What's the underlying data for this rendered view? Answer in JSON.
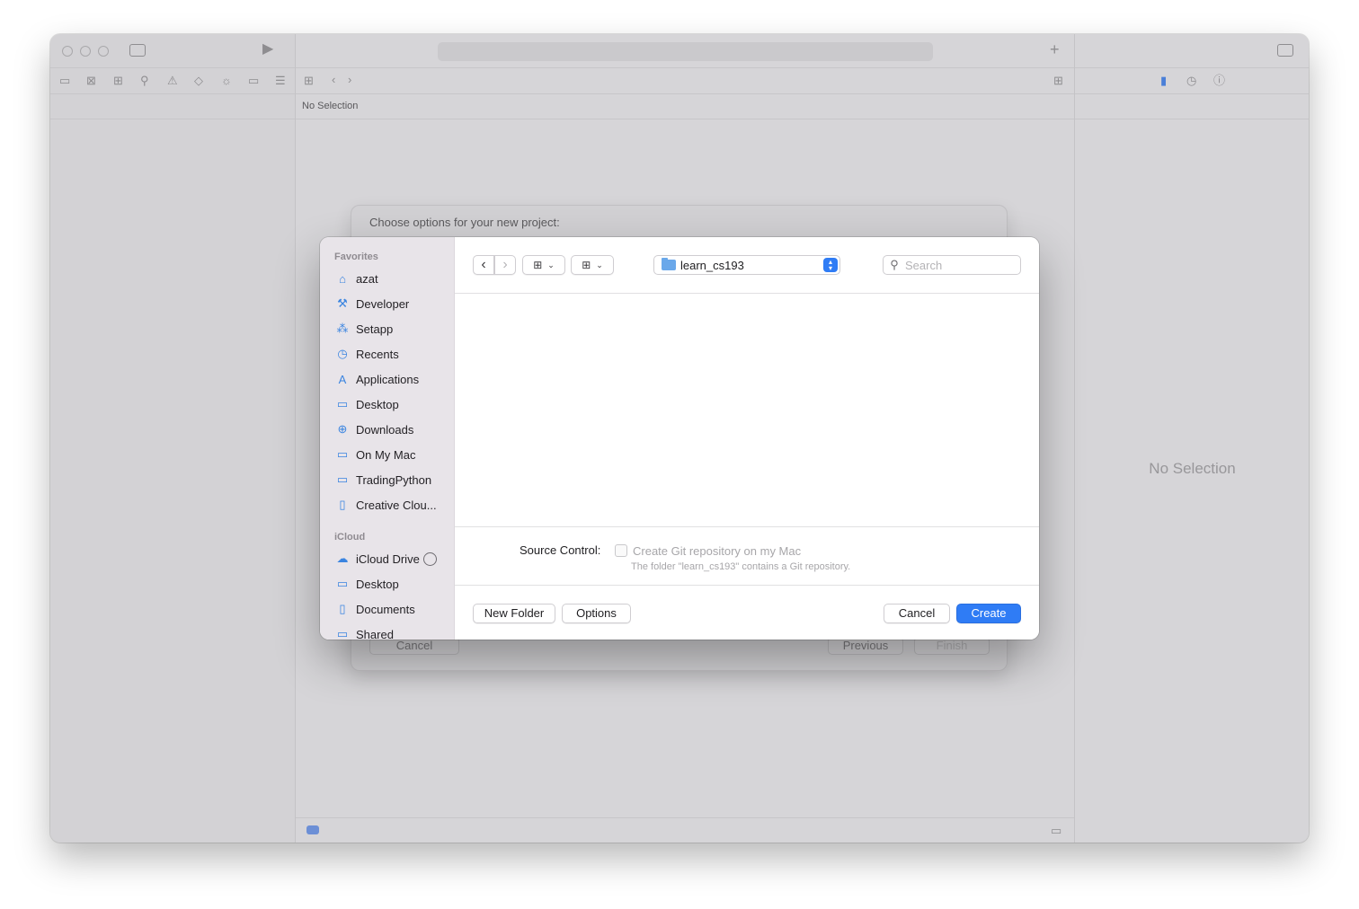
{
  "xcode": {
    "editor_jumpbar_text": "No Selection",
    "inspector_empty_text": "No Selection"
  },
  "background_sheet": {
    "title": "Choose options for your new project:",
    "cancel_label": "Cancel",
    "previous_label": "Previous",
    "finish_label": "Finish"
  },
  "sidebar": {
    "favorites_title": "Favorites",
    "favorites": [
      {
        "label": "azat",
        "icon": "home-icon"
      },
      {
        "label": "Developer",
        "icon": "hammer-icon"
      },
      {
        "label": "Setapp",
        "icon": "setapp-icon"
      },
      {
        "label": "Recents",
        "icon": "clock-icon"
      },
      {
        "label": "Applications",
        "icon": "applications-icon"
      },
      {
        "label": "Desktop",
        "icon": "desktop-icon"
      },
      {
        "label": "Downloads",
        "icon": "download-icon"
      },
      {
        "label": "On My Mac",
        "icon": "folder-icon"
      },
      {
        "label": "TradingPython",
        "icon": "folder-icon"
      },
      {
        "label": "Creative Clou...",
        "icon": "document-icon"
      }
    ],
    "icloud_title": "iCloud",
    "icloud": [
      {
        "label": "iCloud Drive",
        "icon": "cloud-icon"
      },
      {
        "label": "Desktop",
        "icon": "desktop-icon"
      },
      {
        "label": "Documents",
        "icon": "document-icon"
      },
      {
        "label": "Shared",
        "icon": "shared-folder-icon"
      }
    ]
  },
  "toolbar": {
    "current_folder": "learn_cs193",
    "search_placeholder": "Search"
  },
  "options": {
    "source_control_label": "Source Control:",
    "git_checkbox_label": "Create Git repository on my Mac",
    "git_note": "The folder \"learn_cs193\" contains a Git repository."
  },
  "footer": {
    "new_folder_label": "New Folder",
    "options_label": "Options",
    "cancel_label": "Cancel",
    "create_label": "Create"
  },
  "colors": {
    "accent": "#2f7cf5",
    "sidebar_icon": "#3a84e0"
  }
}
